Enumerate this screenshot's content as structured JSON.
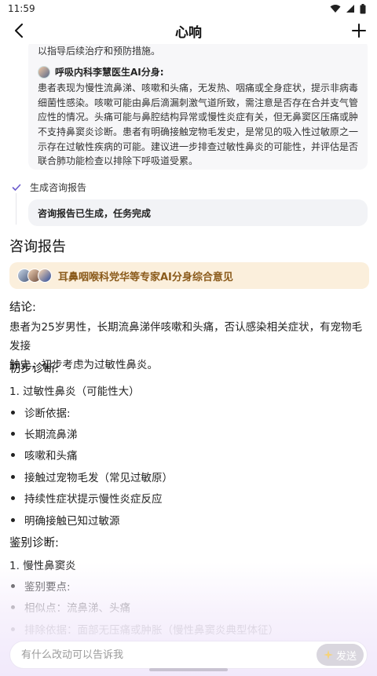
{
  "status_bar": {
    "time": "11:59"
  },
  "nav": {
    "title": "心响"
  },
  "message": {
    "top_line": "以指导后续治疗和预防措施。",
    "doctor_name": "呼吸内科李慧医生AI分身:",
    "lines": [
      "患者表现为慢性流鼻涕、咳嗽和头痛，无发热、咽痛或全身症状，提示非病毒性或",
      "细菌性感染。咳嗽可能由鼻后滴漏刺激气道所致，需注意是否存在合并支气管高反",
      "应性的情况。头痛可能与鼻腔结构异常或慢性炎症有关，但无鼻窦区压痛或肿胀，",
      "不支持鼻窦炎诊断。患者有明确接触宠物毛发史，是常见的吸入性过敏原之一，提",
      "示存在过敏性疾病的可能。建议进一步排查过敏性鼻炎的可能性，并评估是否需要",
      "联合肺功能检查以排除下呼吸道受累。"
    ]
  },
  "step": {
    "label": "生成咨询报告",
    "result": "咨询报告已生成，任务完成"
  },
  "report": {
    "title": "咨询报告",
    "expert_banner": "耳鼻咽喉科党华等专家AI分身综合意见",
    "conclusion_heading": "结论:",
    "conclusion_lines": [
      "患者为25岁男性，长期流鼻涕伴咳嗽和头痛，否认感染相关症状，有宠物毛发接",
      "触史，初步考虑为过敏性鼻炎。"
    ],
    "initial_heading": "初步诊断:",
    "initial_item": "1. 过敏性鼻炎（可能性大）",
    "initial_bullets": [
      "诊断依据:",
      "长期流鼻涕",
      "咳嗽和头痛",
      "接触过宠物毛发（常见过敏原）",
      "持续性症状提示慢性炎症反应",
      "明确接触已知过敏源"
    ],
    "differential_heading": "鉴别诊断:",
    "differential_item": "1. 慢性鼻窦炎",
    "differential_bullets": [
      "鉴别要点:",
      "相似点：流鼻涕、头痛",
      "排除依据：面部无压痛或肿胀（慢性鼻窦炎典型体征）"
    ]
  },
  "input": {
    "placeholder": "有什么改动可以告诉我",
    "send_label": "发送"
  }
}
